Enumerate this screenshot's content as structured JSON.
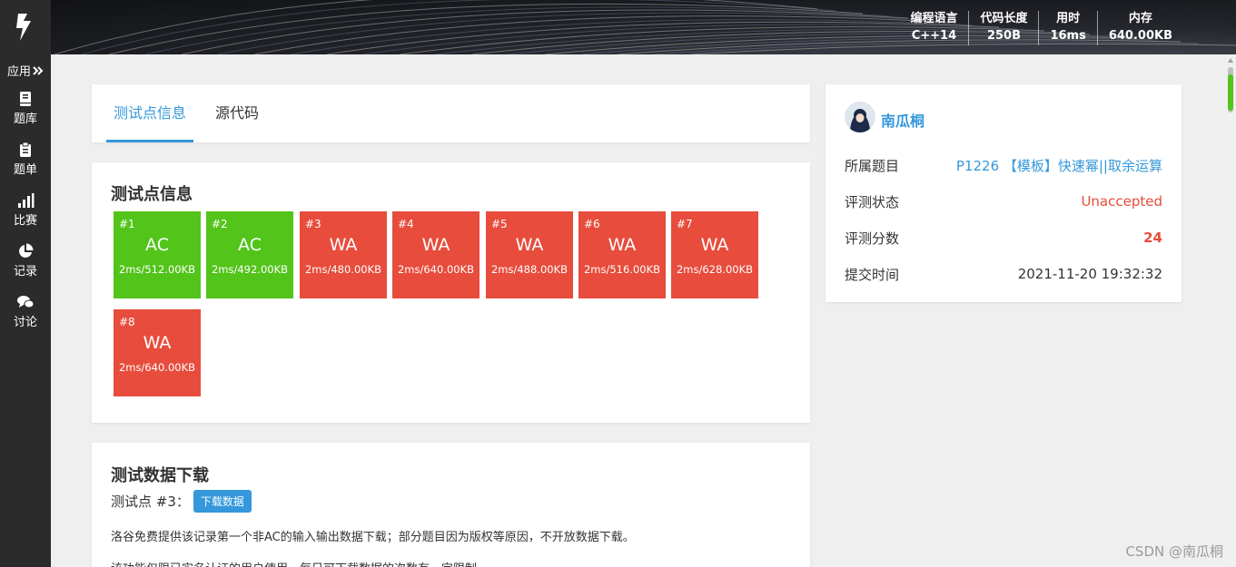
{
  "header": {
    "stats": [
      {
        "label": "编程语言",
        "value": "C++14"
      },
      {
        "label": "代码长度",
        "value": "250B"
      },
      {
        "label": "用时",
        "value": "16ms"
      },
      {
        "label": "内存",
        "value": "640.00KB"
      }
    ]
  },
  "sidebar": {
    "apps_label": "应用",
    "items": [
      {
        "label": "题库",
        "icon": "book-icon"
      },
      {
        "label": "题单",
        "icon": "clipboard-icon"
      },
      {
        "label": "比赛",
        "icon": "bar-chart-icon"
      },
      {
        "label": "记录",
        "icon": "pie-chart-icon"
      },
      {
        "label": "讨论",
        "icon": "chat-icon"
      }
    ]
  },
  "tabs": {
    "test_info": "测试点信息",
    "source": "源代码"
  },
  "test_info": {
    "title": "测试点信息",
    "cases": [
      {
        "num": "#1",
        "status": "AC",
        "result": "2ms/512.00KB",
        "color": "#52c41a"
      },
      {
        "num": "#2",
        "status": "AC",
        "result": "2ms/492.00KB",
        "color": "#52c41a"
      },
      {
        "num": "#3",
        "status": "WA",
        "result": "2ms/480.00KB",
        "color": "#e74c3c"
      },
      {
        "num": "#4",
        "status": "WA",
        "result": "2ms/640.00KB",
        "color": "#e74c3c"
      },
      {
        "num": "#5",
        "status": "WA",
        "result": "2ms/488.00KB",
        "color": "#e74c3c"
      },
      {
        "num": "#6",
        "status": "WA",
        "result": "2ms/516.00KB",
        "color": "#e74c3c"
      },
      {
        "num": "#7",
        "status": "WA",
        "result": "2ms/628.00KB",
        "color": "#e74c3c"
      },
      {
        "num": "#8",
        "status": "WA",
        "result": "2ms/640.00KB",
        "color": "#e74c3c"
      }
    ]
  },
  "download": {
    "title": "测试数据下载",
    "case_label": "测试点 #3：",
    "button": "下载数据",
    "note": "洛谷免费提供该记录第一个非AC的输入输出数据下载；部分题目因为版权等原因，不开放数据下载。",
    "note2": "该功能仅限已实名认证的用户使用，每日可下载数据的次数有一定限制。"
  },
  "user": {
    "name": "南瓜桐",
    "rows": [
      {
        "key": "所属题目",
        "value": "P1226 【模板】快速幂||取余运算"
      },
      {
        "key": "评测状态",
        "value": "Unaccepted"
      },
      {
        "key": "评测分数",
        "value": "24"
      },
      {
        "key": "提交时间",
        "value": "2021-11-20 19:32:32"
      }
    ]
  },
  "watermark": "CSDN @南瓜桐",
  "colors": {
    "accent": "#3498db",
    "ac": "#52c41a",
    "wa": "#e74c3c",
    "sidebar": "#2b2b2b"
  }
}
